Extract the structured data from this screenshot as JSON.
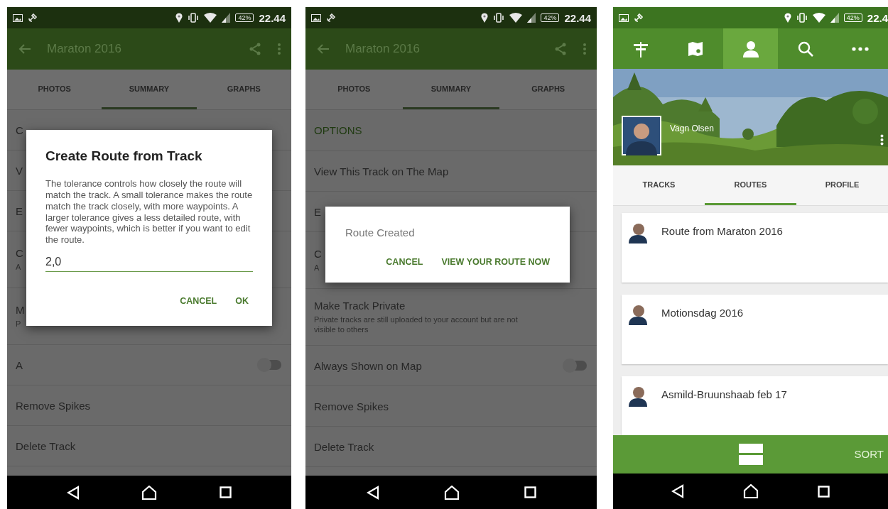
{
  "screens": [
    {
      "kind": "track",
      "status_bar": {
        "battery": "42%",
        "time": "22.44"
      },
      "app_bar": {
        "title": "Maraton 2016"
      },
      "tabs": [
        {
          "label": "PHOTOS",
          "selected": false
        },
        {
          "label": "SUMMARY",
          "selected": true
        },
        {
          "label": "GRAPHS",
          "selected": false
        }
      ],
      "rows": [
        {
          "kind": "item",
          "title": "C"
        },
        {
          "kind": "item",
          "title": "V"
        },
        {
          "kind": "item",
          "title": "E"
        },
        {
          "kind": "item",
          "title": "C",
          "subtitle": "A"
        },
        {
          "kind": "item",
          "title": "M",
          "subtitle": "P"
        },
        {
          "kind": "toggle",
          "title": "A",
          "on": false
        },
        {
          "kind": "item",
          "title": "Remove Spikes"
        },
        {
          "kind": "item",
          "title": "Delete Track"
        }
      ],
      "dialog": {
        "kind": "input",
        "title": "Create Route from Track",
        "message": "The tolerance controls how closely the route will match the track. A small tolerance makes the route match the track closely, with more waypoints. A larger tolerance gives a less detailed route, with fewer waypoints, which is better if you want to edit the route.",
        "value": "2,0",
        "buttons": [
          "CANCEL",
          "OK"
        ]
      }
    },
    {
      "kind": "track",
      "status_bar": {
        "battery": "42%",
        "time": "22.44"
      },
      "app_bar": {
        "title": "Maraton 2016"
      },
      "tabs": [
        {
          "label": "PHOTOS",
          "selected": false
        },
        {
          "label": "SUMMARY",
          "selected": true
        },
        {
          "label": "GRAPHS",
          "selected": false
        }
      ],
      "rows": [
        {
          "kind": "header",
          "title": "OPTIONS"
        },
        {
          "kind": "item",
          "title": "View This Track on The Map"
        },
        {
          "kind": "item",
          "title": "E"
        },
        {
          "kind": "item",
          "title": "C",
          "subtitle": "A"
        },
        {
          "kind": "item",
          "title": "Make Track Private",
          "subtitle": "Private tracks are still uploaded to your account but are not visible to others"
        },
        {
          "kind": "toggle",
          "title": "Always Shown on Map",
          "on": false
        },
        {
          "kind": "item",
          "title": "Remove Spikes"
        },
        {
          "kind": "item",
          "title": "Delete Track"
        }
      ],
      "dialog": {
        "kind": "message",
        "title": "Route Created",
        "buttons": [
          "CANCEL",
          "VIEW YOUR ROUTE NOW"
        ]
      }
    },
    {
      "kind": "profile",
      "status_bar": {
        "battery": "42%",
        "time": "22.4"
      },
      "nav": [
        {
          "kind": "signpost",
          "selected": false
        },
        {
          "kind": "map",
          "selected": false
        },
        {
          "kind": "person",
          "selected": true
        },
        {
          "kind": "search",
          "selected": false
        },
        {
          "kind": "more",
          "selected": false
        }
      ],
      "user": {
        "name": "Vagn Olsen"
      },
      "tabs": [
        {
          "label": "TRACKS",
          "selected": false
        },
        {
          "label": "ROUTES",
          "selected": true
        },
        {
          "label": "PROFILE",
          "selected": false
        }
      ],
      "cards": [
        {
          "title": "Route from Maraton 2016"
        },
        {
          "title": "Motionsdag 2016"
        },
        {
          "title": "Asmild-Bruunshaab feb 17"
        }
      ],
      "bottom_bar": {
        "action": "SORT"
      }
    }
  ]
}
